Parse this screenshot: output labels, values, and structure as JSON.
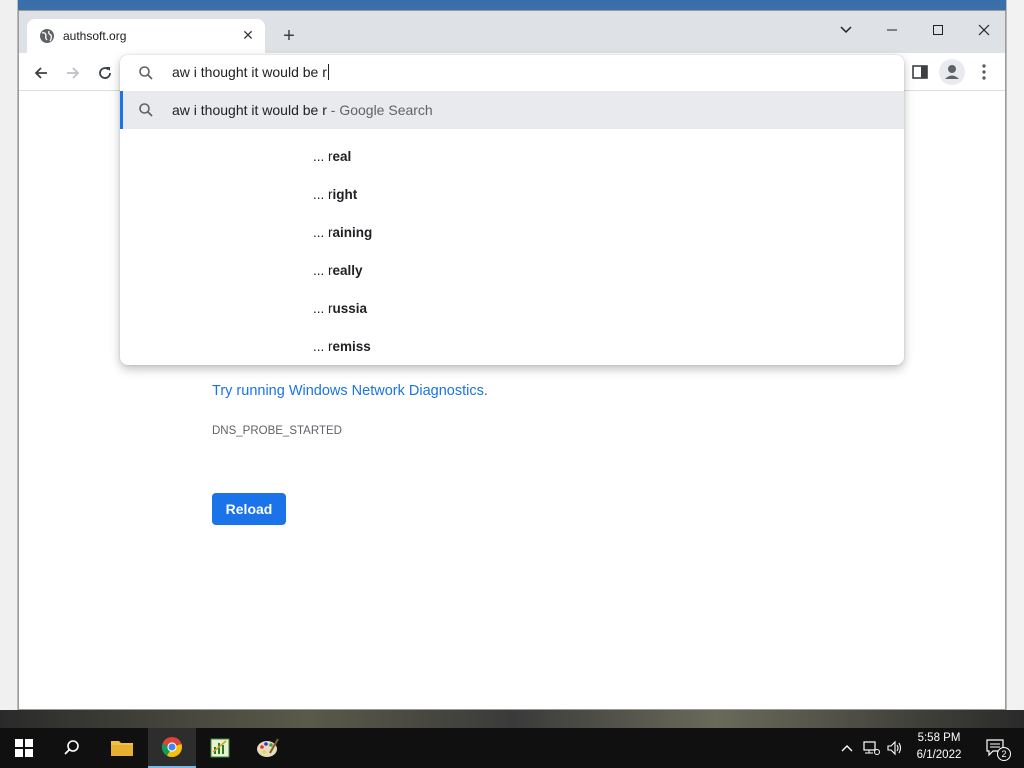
{
  "browser": {
    "tab_title": "authsoft.org",
    "tab_close": "✕",
    "new_tab": "+"
  },
  "omnibox": {
    "input_value": "aw i thought it would be r",
    "selected_query": "aw i thought it would be r",
    "selected_suffix": " - Google Search",
    "suggestions": [
      {
        "prefix": "... r",
        "rest": "eal"
      },
      {
        "prefix": "... r",
        "rest": "ight"
      },
      {
        "prefix": "... r",
        "rest": "aining"
      },
      {
        "prefix": "... r",
        "rest": "eally"
      },
      {
        "prefix": "... r",
        "rest": "ussia"
      },
      {
        "prefix": "... r",
        "rest": "emiss"
      }
    ]
  },
  "page": {
    "diagnostics_link": "Try running Windows Network Diagnostics",
    "diagnostics_period": ".",
    "error_code": "DNS_PROBE_STARTED",
    "reload_label": "Reload"
  },
  "taskbar": {
    "time": "5:58 PM",
    "date": "6/1/2022",
    "notification_count": "2"
  },
  "colors": {
    "accent": "#1a73e8",
    "taskbar": "#101010"
  }
}
